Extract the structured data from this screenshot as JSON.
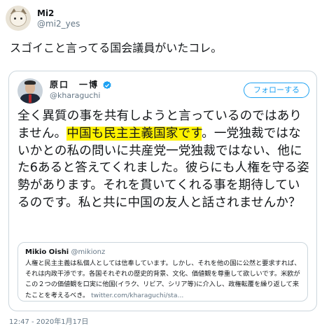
{
  "author": {
    "display_name": "Mi2",
    "handle": "@mi2_yes"
  },
  "tweet": {
    "text": "スゴイこと言ってる国会議員がいたコレ。"
  },
  "quoted": {
    "display_name": "原口　一博",
    "handle": "@kharaguchi",
    "follow_label": "フォローする",
    "body_before": "全く異質の事を共有しようと言っているのではありません。",
    "body_highlight": "中国も民主主義国家です",
    "body_after": "。一党独裁ではないかとの私の問いに共産党一党独裁ではない、他にた6あると答えてくれました。彼らにも人権を守る姿勢があります。それを貫いてくれる事を期待しているのです。私と共に中国の友人と話されませんか？",
    "highlight_color": "#fff200",
    "inner": {
      "display_name": "Mikio Oishi",
      "handle": "@mikionz",
      "text": "人権と民主主義は私個人としては信奉しています。しかし、それを他の国に公然と要求すれば、それは内政干渉です。各国それぞれの歴史的背景、文化、価値観を尊重して欲しいです。米欧がこの２つの価値観を口実に他国(イラク、リビア、シリア等)に介入し、政権転覆を繰り返して来たことを考えるべき。",
      "link": "twitter.com/kharaguchi/sta..."
    }
  },
  "timestamp": "12:47 - 2020年1月17日",
  "colors": {
    "accent": "#1da1f2",
    "secondary_text": "#657786",
    "border": "#ccd6dd"
  }
}
